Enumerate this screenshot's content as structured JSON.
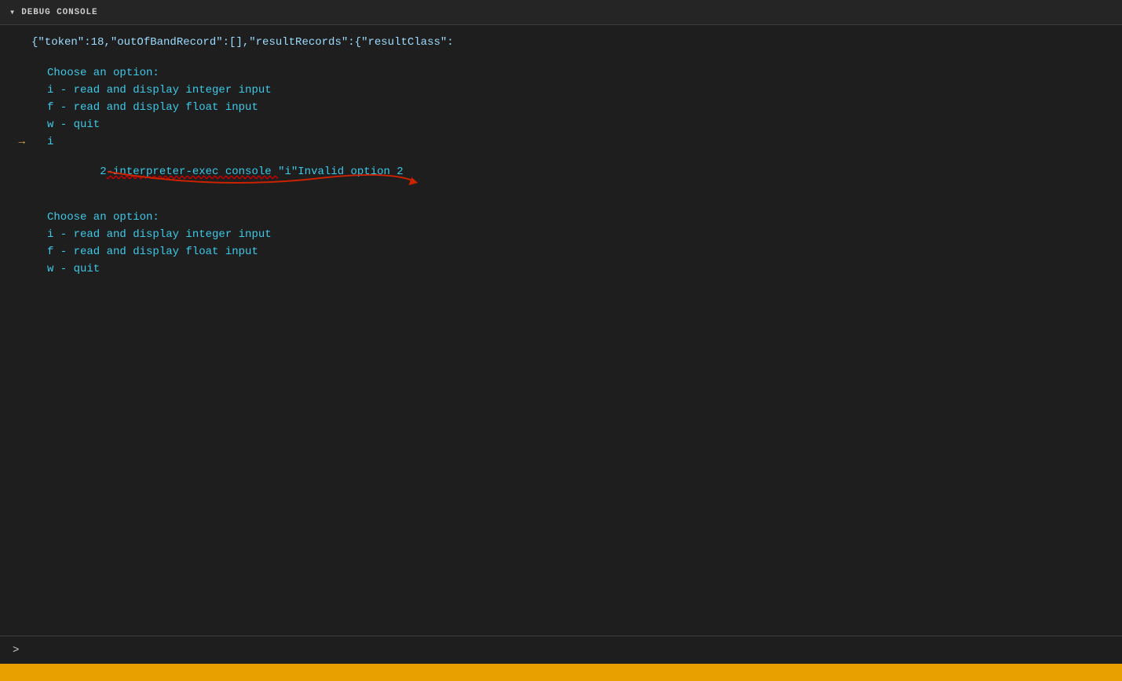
{
  "header": {
    "chevron": "▾",
    "title": "DEBUG CONSOLE"
  },
  "console": {
    "json_output": "{\"token\":18,\"outOfBandRecord\":[],\"resultRecords\":{\"resultClass\":",
    "block1": {
      "choose": "Choose an option:",
      "option_i": "i - read and display integer input",
      "option_f": "f - read and display float input",
      "option_w": "w - quit"
    },
    "input_i": "i",
    "error_line": "2-interpreter-exec console \"i\"Invalid option 2",
    "block2": {
      "choose": "Choose an option:",
      "option_i": "i - read and display integer input",
      "option_f": "f - read and display float input",
      "option_w": "w - quit"
    },
    "input_prompt": ">"
  }
}
